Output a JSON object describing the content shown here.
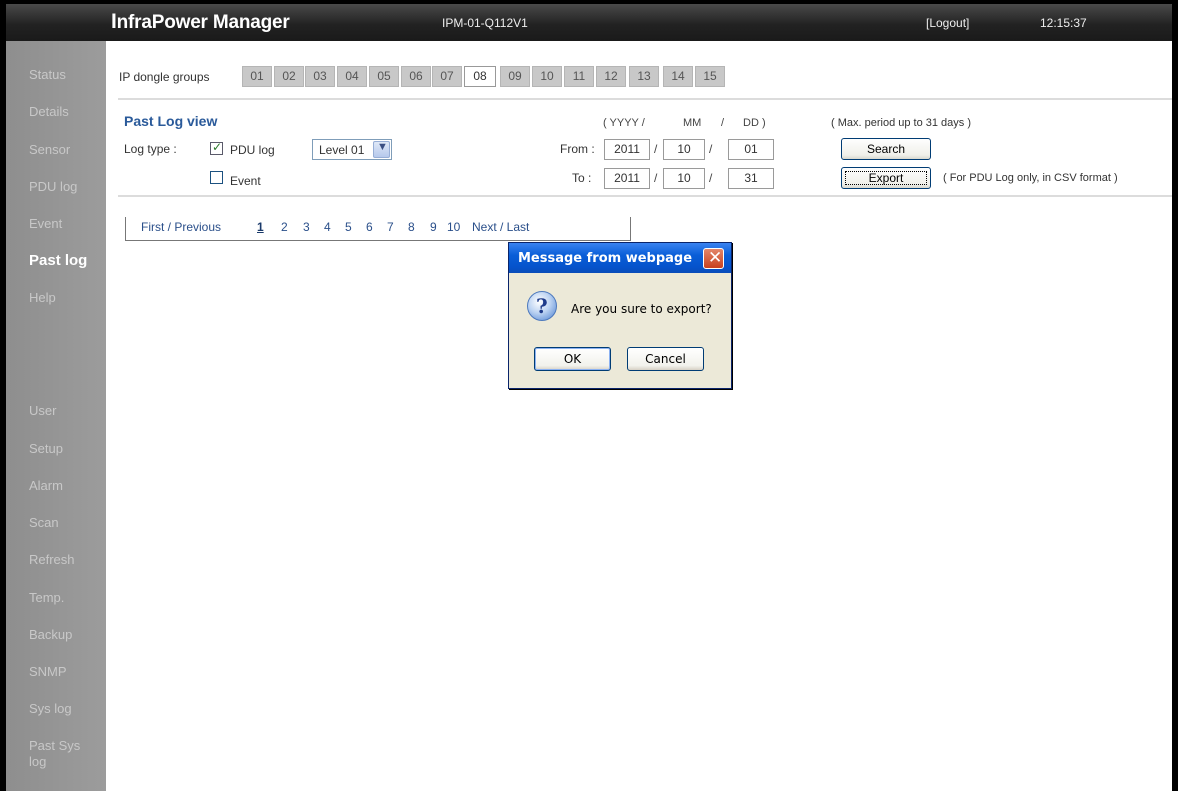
{
  "header": {
    "brand_first": "I",
    "brand_rest": "nfraPower Manager",
    "device_id": "IPM-01-Q112V1",
    "logout": "[Logout]",
    "time": "12:15:37"
  },
  "sidebar": {
    "items": [
      {
        "label": "Status"
      },
      {
        "label": "Details"
      },
      {
        "label": "Sensor"
      },
      {
        "label": "PDU log"
      },
      {
        "label": "Event"
      },
      {
        "label": "Past log",
        "active": true
      },
      {
        "label": "Help"
      },
      {
        "label": "User"
      },
      {
        "label": "Setup"
      },
      {
        "label": "Alarm"
      },
      {
        "label": "Scan"
      },
      {
        "label": "Refresh"
      },
      {
        "label": "Temp."
      },
      {
        "label": "Backup"
      },
      {
        "label": "SNMP"
      },
      {
        "label": "Sys log"
      },
      {
        "label": "Past Sys"
      },
      {
        "label": "log"
      }
    ]
  },
  "groups": {
    "label": "IP dongle groups",
    "items": [
      "01",
      "02",
      "03",
      "04",
      "05",
      "06",
      "07",
      "08",
      "09",
      "10",
      "11",
      "12",
      "13",
      "14",
      "15"
    ],
    "selected": "08"
  },
  "past_log": {
    "title": "Past Log view",
    "log_type_label": "Log type :",
    "pdu_log_label": "PDU log",
    "pdu_log_checked": true,
    "level_value": "Level 01",
    "event_label": "Event",
    "event_checked": false,
    "format_yyyy": "( YYYY  /",
    "format_mm": "MM",
    "format_slash": "/",
    "format_dd": "DD )",
    "from_label": "From :",
    "to_label": "To :",
    "from": {
      "yyyy": "2011",
      "mm": "10",
      "dd": "01"
    },
    "to": {
      "yyyy": "2011",
      "mm": "10",
      "dd": "31"
    },
    "date_sep": "/",
    "max_note": "( Max. period up to 31 days )",
    "search_label": "Search",
    "export_label": "Export",
    "export_note": "( For PDU Log only, in CSV format )"
  },
  "pager": {
    "first_prev": "First / Previous",
    "pages": [
      "1",
      "2",
      "3",
      "4",
      "5",
      "6",
      "7",
      "8",
      "9",
      "10"
    ],
    "current": "1",
    "next_last": "Next / Last"
  },
  "dialog": {
    "title": "Message from webpage",
    "message": "Are you sure to export?",
    "ok": "OK",
    "cancel": "Cancel",
    "close_glyph": "✕",
    "question_glyph": "?",
    "icon": "question-icon"
  },
  "glyphs": {
    "check": "✓",
    "dropdown": "▼"
  },
  "colors": {
    "accent": "#2a5a9a",
    "sidebar": "#9a9a9a",
    "header": "#222222",
    "dialog_title": "#0553cc"
  }
}
